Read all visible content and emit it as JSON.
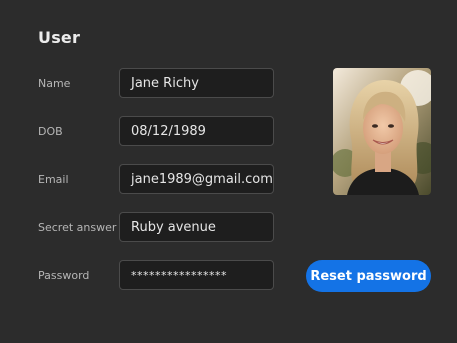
{
  "form": {
    "title": "User",
    "fields": [
      {
        "label": "Name",
        "value": "Jane Richy"
      },
      {
        "label": "DOB",
        "value": "08/12/1989"
      },
      {
        "label": "Email",
        "value": "jane1989@gmail.com"
      },
      {
        "label": "Secret answer",
        "value": "Ruby avenue"
      },
      {
        "label": "Password",
        "value": "****************"
      }
    ],
    "reset_label": "Reset password"
  },
  "colors": {
    "background": "#2c2c2c",
    "field_background": "#1e1e1e",
    "field_border": "#4b4b4b",
    "accent": "#1473e6"
  }
}
